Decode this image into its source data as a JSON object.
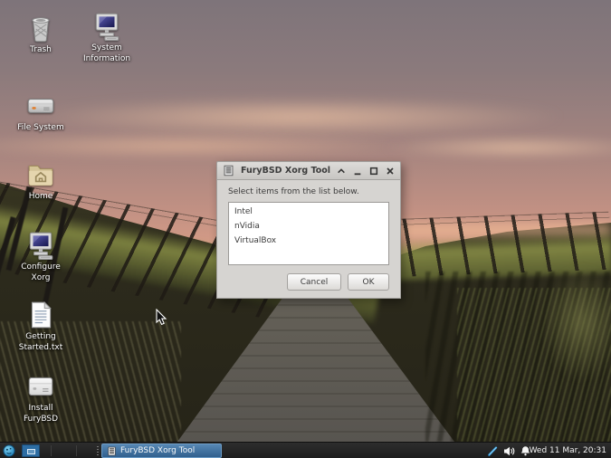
{
  "desktop": {
    "icons": [
      {
        "label": "Trash"
      },
      {
        "label": "System\nInformation"
      },
      {
        "label": "File System"
      },
      {
        "label": "Home"
      },
      {
        "label": "Configure\nXorg"
      },
      {
        "label": "Getting\nStarted.txt"
      },
      {
        "label": "Install\nFuryBSD"
      }
    ]
  },
  "dialog": {
    "title": "FuryBSD Xorg Tool",
    "message": "Select items from the list below.",
    "list_items": [
      "Intel",
      "nVidia",
      "VirtualBox"
    ],
    "cancel_label": "Cancel",
    "ok_label": "OK",
    "window_controls": [
      "shade",
      "minimize",
      "maximize",
      "close"
    ]
  },
  "taskbar": {
    "task_button_label": "FuryBSD Xorg Tool",
    "clock": "Wed 11 Mar, 20:31",
    "tray_icons": [
      "pen-icon",
      "volume-icon",
      "bell-icon"
    ]
  },
  "colors": {
    "selection_blue": "#31608e",
    "panel_bg": "#222222",
    "dialog_bg": "#d6d4d1",
    "sky_top": "#7e747a",
    "sky_peach": "#f3bd98",
    "pager_blue": "#2d6da3"
  }
}
